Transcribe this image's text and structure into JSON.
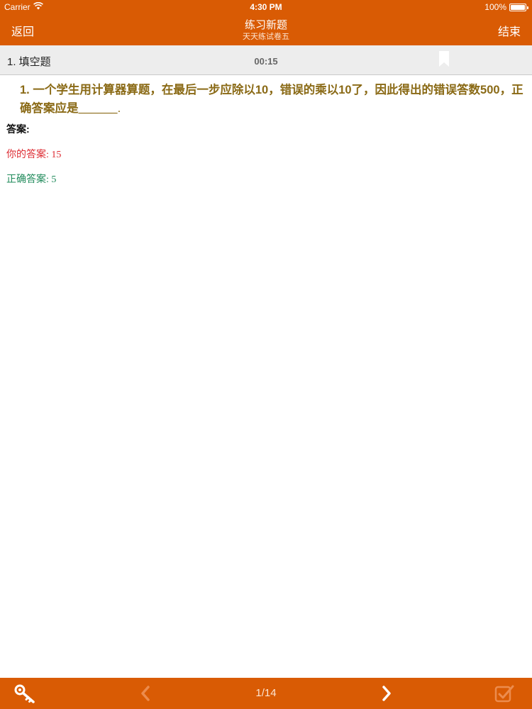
{
  "status_bar": {
    "carrier": "Carrier",
    "time": "4:30 PM",
    "battery": "100%"
  },
  "nav": {
    "back_label": "返回",
    "title": "练习新题",
    "subtitle": "天天练试卷五",
    "end_label": "结束"
  },
  "question_bar": {
    "type_label": "1. 填空题",
    "timer": "00:15"
  },
  "question": {
    "text": "1. 一个学生用计算器算题，在最后一步应除以10，错误的乘以10了，因此得出的错误答数500，正确答案应是",
    "blank": "______",
    "tail": "."
  },
  "answer": {
    "heading": "答案:",
    "your_answer": "你的答案: 15",
    "correct_answer": "正确答案: 5"
  },
  "bottom_bar": {
    "pager": "1/14",
    "icons": [
      "key-icon",
      "chevron-left-icon",
      "chevron-right-icon",
      "checkbox-check-icon"
    ]
  },
  "colors": {
    "brand": "#d95b04",
    "question_text": "#8a6a16",
    "wrong": "#dd2b32",
    "correct": "#1f8a5a"
  }
}
